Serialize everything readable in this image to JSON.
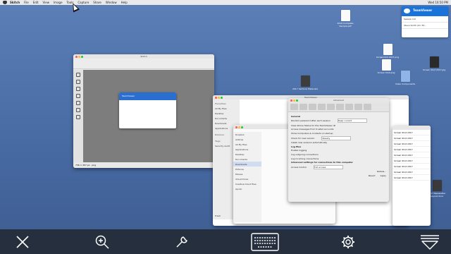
{
  "menubar": {
    "app": "Skitch",
    "items": [
      "File",
      "Edit",
      "View",
      "Image",
      "Tools",
      "Capture",
      "Share",
      "Window",
      "Help"
    ],
    "right": [
      "Wed 10:50 PM"
    ]
  },
  "desktop_icons": [
    {
      "label": "2016 Complete Sample.pdf"
    },
    {
      "label": "Screenshot 2017.png"
    },
    {
      "label": "Screen Shot 2017.jpg"
    },
    {
      "label": "Screen Shot.png"
    },
    {
      "label": "Video Components"
    },
    {
      "label": "2017 Seminar Materials"
    },
    {
      "label": "2017 Newsletter Layout.docx"
    }
  ],
  "teamviewer_notification": {
    "title": "TeamViewer",
    "rows": [
      "Session list",
      "Steve Smith (ID: 83..."
    ]
  },
  "skitch_window": {
    "title": "Skitch",
    "status": "736 × 457 px  ·  png",
    "inner_title": "TeamViewer"
  },
  "finder_window": {
    "title": "TeamViewer",
    "sidebar": [
      "Favorites",
      "All My Files",
      "Desktop",
      "Documents",
      "Downloads",
      "Applications",
      "Devices",
      "Tags",
      "Security Audit"
    ],
    "footer": "Trash"
  },
  "prefs_window": {
    "title": "Advanced",
    "lines": [
      "General",
      "Random password after each session",
      "View Online Status for this TeamViewer ID",
      "Access messages from trusted accounts",
      "Show Computers & Contacts on startup",
      "Check for new version",
      "Install new versions automatically",
      "Log files",
      "Enable logging",
      "Log outgoing connections",
      "Log incoming connections",
      "Advanced settings for connections to this computer",
      "Access Control"
    ],
    "select_random": "Keep current",
    "select_check": "Weekly",
    "select_access": "Full Access",
    "button_details": "Details...",
    "button_revert": "Revert",
    "button_apply": "Apply"
  },
  "dialog_window": {
    "items": [
      "Dropbox",
      "AirDrop",
      "All My Files",
      "Applications",
      "Desktop",
      "Documents",
      "Downloads",
      "Pictures",
      "Movies",
      "iCloud Drive",
      "Creative Cloud Files",
      "Apollo"
    ]
  },
  "stack_window": {
    "rows": [
      "Screen Shot 2017",
      "Screen Shot 2017",
      "Screen Shot 2017",
      "Screen Shot 2017",
      "Screen Shot 2017",
      "Screen Shot 2017",
      "Screen Shot 2017",
      "Screen Shot 2017",
      "Screen Shot 2017"
    ]
  },
  "toolbar": {
    "buttons": [
      {
        "name": "close-button",
        "icon": "close-icon"
      },
      {
        "name": "zoom-button",
        "icon": "zoom-in-icon"
      },
      {
        "name": "tools-button",
        "icon": "wrench-icon"
      },
      {
        "name": "keyboard-button",
        "icon": "keyboard-icon"
      },
      {
        "name": "settings-button",
        "icon": "gear-icon"
      },
      {
        "name": "collapse-button",
        "icon": "collapse-icon"
      }
    ]
  }
}
